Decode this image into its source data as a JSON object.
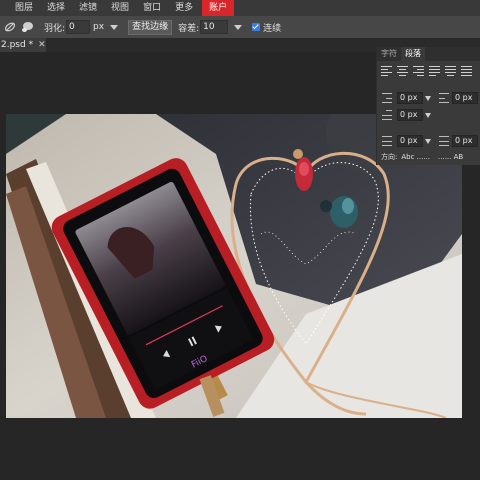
{
  "menu": {
    "items": [
      "图层",
      "选择",
      "滤镜",
      "视图",
      "窗口",
      "更多"
    ],
    "account": "账户"
  },
  "options": {
    "feather_label": "羽化:",
    "feather_value": "0",
    "feather_unit": "px",
    "refine_edge_button": "查找边缘",
    "tolerance_label": "容差:",
    "tolerance_value": "10",
    "contiguous_label": "连续",
    "contiguous_checked": true
  },
  "document": {
    "tab_label": "2.psd *",
    "close_glyph": "✕"
  },
  "panel": {
    "tabs": [
      "字符",
      "段落"
    ],
    "active_tab": "段落",
    "indent_left": "0 px",
    "indent_right": "0 px",
    "indent_first": "0 px",
    "space_before": "0 px",
    "space_after": "0 px",
    "direction_label": "方向:",
    "direction_ltr": "Abc ......",
    "direction_rtl": "...... AB"
  },
  "colors": {
    "menubar": "#393939",
    "accent": "#d9262b",
    "checkbox": "#3b7de8"
  }
}
